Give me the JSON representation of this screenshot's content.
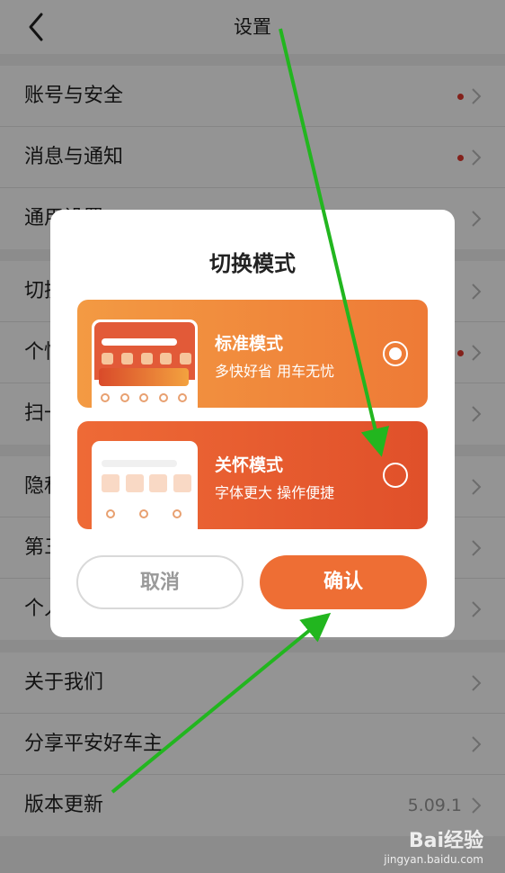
{
  "header": {
    "title": "设置"
  },
  "settings": {
    "group1": [
      {
        "label": "账号与安全",
        "dot": true
      },
      {
        "label": "消息与通知",
        "dot": true
      },
      {
        "label": "通用设置",
        "dot": false
      }
    ],
    "group2": [
      {
        "label": "切换模式",
        "dot": false
      },
      {
        "label": "个性化推荐",
        "dot": true
      },
      {
        "label": "扫一扫",
        "dot": false
      }
    ],
    "group3": [
      {
        "label": "隐私设置",
        "dot": false
      },
      {
        "label": "第三方信息共享",
        "dot": false
      },
      {
        "label": "个人信息收集",
        "dot": false
      }
    ],
    "group4": [
      {
        "label": "关于我们"
      },
      {
        "label": "分享平安好车主"
      },
      {
        "label": "版本更新",
        "value": "5.09.1"
      }
    ]
  },
  "modal": {
    "title": "切换模式",
    "standard": {
      "name": "标准模式",
      "desc": "多快好省 用车无忧",
      "selected": true
    },
    "care": {
      "name": "关怀模式",
      "desc": "字体更大 操作便捷",
      "selected": false
    },
    "cancel": "取消",
    "confirm": "确认"
  },
  "watermark": {
    "logo": "Bai经验",
    "url": "jingyan.baidu.com"
  },
  "colors": {
    "accent": "#ee6e34",
    "dot": "#e23a2f",
    "arrow": "#22b61f"
  }
}
